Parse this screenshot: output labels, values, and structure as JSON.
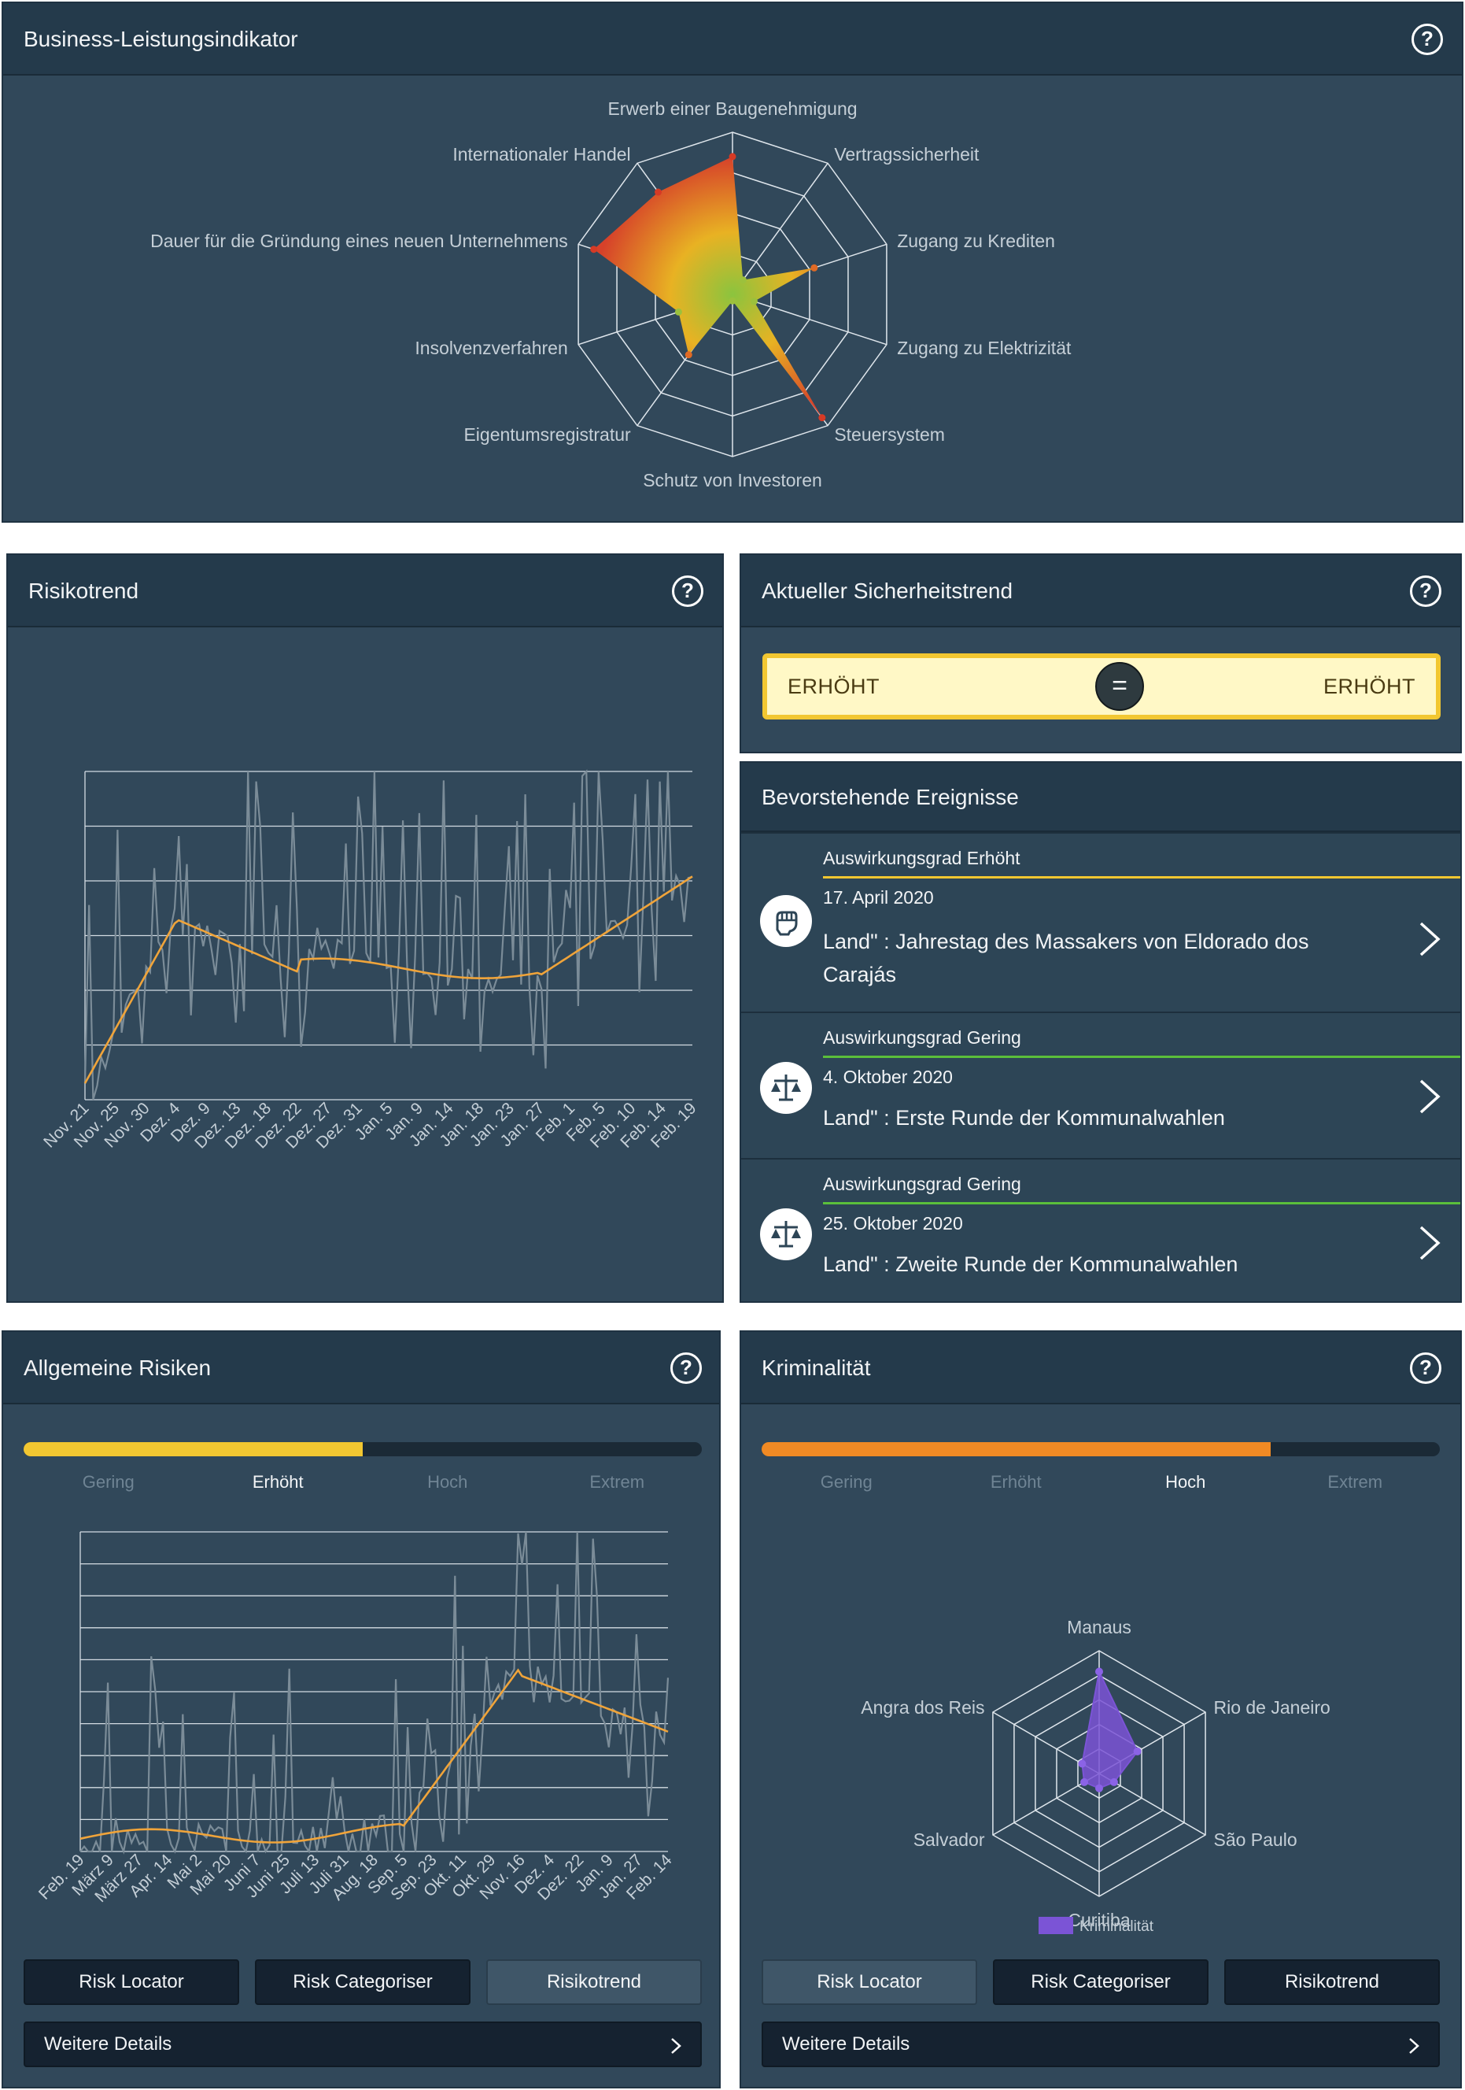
{
  "business": {
    "title": "Business-Leistungsindikator",
    "axes": [
      "Erwerb einer Baugenehmigung",
      "Vertragssicherheit",
      "Zugang zu Krediten",
      "Zugang zu Elektrizität",
      "Steuersystem",
      "Schutz von Investoren",
      "Eigentumsregistratur",
      "Insolvenzverfahren",
      "Dauer für die Gründung eines neuen Unternehmens",
      "Internationaler Handel"
    ],
    "values": [
      0.85,
      0.11,
      0.53,
      0.14,
      0.94,
      0.04,
      0.46,
      0.35,
      0.9,
      0.78
    ],
    "grid_levels": 4
  },
  "risikotrend": {
    "title": "Risikotrend",
    "x_labels": [
      "Nov. 21",
      "Nov. 25",
      "Nov. 30",
      "Dez. 4",
      "Dez. 9",
      "Dez. 13",
      "Dez. 18",
      "Dez. 22",
      "Dez. 27",
      "Dez. 31",
      "Jan. 5",
      "Jan. 9",
      "Jan. 14",
      "Jan. 18",
      "Jan. 23",
      "Jan. 27",
      "Feb. 1",
      "Feb. 5",
      "Feb. 10",
      "Feb. 14",
      "Feb. 19"
    ],
    "grid_lines": 6
  },
  "sicherheit": {
    "title": "Aktueller Sicherheitstrend",
    "left": "ERHÖHT",
    "symbol": "=",
    "right": "ERHÖHT"
  },
  "events": {
    "title": "Bevorstehende Ereignisse",
    "items": [
      {
        "level": "Auswirkungsgrad Erhöht",
        "date": "17. April 2020",
        "title": "Land\" : Jahrestag des Massakers von Eldorado dos Carajás",
        "color": "#f2c731",
        "icon": "fist"
      },
      {
        "level": "Auswirkungsgrad Gering",
        "date": "4. Oktober 2020",
        "title": "Land\" : Erste Runde der Kommunalwahlen",
        "color": "#5bbf3b",
        "icon": "scales"
      },
      {
        "level": "Auswirkungsgrad Gering",
        "date": "25. Oktober 2020",
        "title": "Land\" : Zweite Runde der Kommunalwahlen",
        "color": "#5bbf3b",
        "icon": "scales"
      }
    ]
  },
  "allgemein": {
    "title": "Allgemeine Risiken",
    "levels": [
      "Gering",
      "Erhöht",
      "Hoch",
      "Extrem"
    ],
    "active_level": 1,
    "bar_fraction": 0.5,
    "bar_color": "#f2c731",
    "x_labels": [
      "Feb. 19",
      "März 9",
      "März 27",
      "Apr. 14",
      "Mai 2",
      "Mai 20",
      "Juni 7",
      "Juni 25",
      "Juli 13",
      "Juli 31",
      "Aug. 18",
      "Sep. 5",
      "Sep. 23",
      "Okt. 11",
      "Okt. 29",
      "Nov. 16",
      "Dez. 4",
      "Dez. 22",
      "Jan. 9",
      "Jan. 27",
      "Feb. 14"
    ],
    "grid_lines": 10,
    "buttons": [
      "Risk Locator",
      "Risk Categoriser",
      "Risikotrend"
    ],
    "active_button": 2,
    "more": "Weitere Details"
  },
  "krimi": {
    "title": "Kriminalität",
    "levels": [
      "Gering",
      "Erhöht",
      "Hoch",
      "Extrem"
    ],
    "active_level": 2,
    "bar_fraction": 0.75,
    "bar_color": "#f08a24",
    "axes": [
      "Manaus",
      "Rio de Janeiro",
      "São Paulo",
      "Curitiba",
      "Salvador",
      "Angra dos Reis"
    ],
    "values": [
      0.83,
      0.36,
      0.14,
      0.12,
      0.14,
      0.16
    ],
    "legend": "Kriminalität",
    "series_color": "#7b54d6",
    "buttons": [
      "Risk Locator",
      "Risk Categoriser",
      "Risikotrend"
    ],
    "active_button": 0,
    "more": "Weitere Details"
  },
  "help_symbol": "?"
}
